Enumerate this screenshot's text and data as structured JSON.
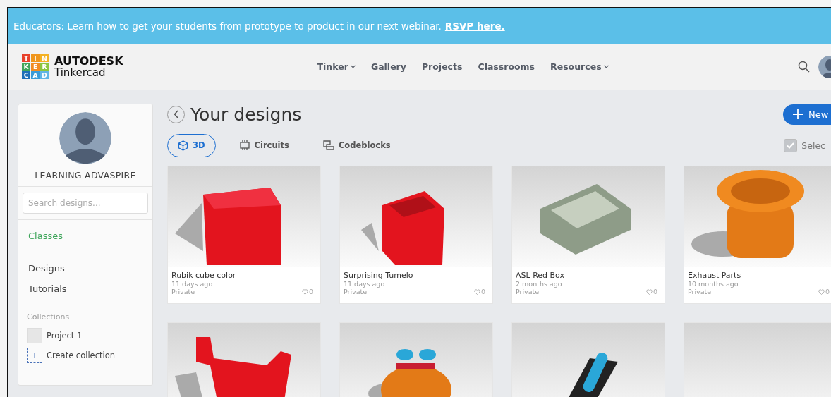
{
  "banner": {
    "text": "Educators: Learn how to get your students from prototype to product in our next webinar.",
    "link": "RSVP here."
  },
  "header": {
    "logo": {
      "tiles": [
        "T",
        "I",
        "N",
        "K",
        "E",
        "R",
        "C",
        "A",
        "D"
      ],
      "brand": "AUTODESK",
      "product": "Tinkercad"
    },
    "nav": [
      {
        "label": "Tinker",
        "dropdown": true
      },
      {
        "label": "Gallery",
        "dropdown": false
      },
      {
        "label": "Projects",
        "dropdown": false
      },
      {
        "label": "Classrooms",
        "dropdown": false
      },
      {
        "label": "Resources",
        "dropdown": true
      }
    ]
  },
  "sidebar": {
    "user_name": "LEARNING ADVASPIRE",
    "search": {
      "placeholder": "Search designs..."
    },
    "links": [
      {
        "label": "Classes",
        "accent": true
      }
    ],
    "menu": [
      {
        "label": "Designs",
        "accent": false
      },
      {
        "label": "Tutorials",
        "accent": false
      }
    ],
    "collections_heading": "Collections",
    "collections": [
      {
        "label": "Project 1",
        "kind": "collection"
      },
      {
        "label": "+",
        "kind": "create"
      }
    ],
    "create_label": "Create collection"
  },
  "main": {
    "title": "Your designs",
    "new_button": "New",
    "tabs": [
      {
        "label": "3D",
        "selected": true
      },
      {
        "label": "Circuits",
        "selected": false
      },
      {
        "label": "Codeblocks",
        "selected": false
      }
    ],
    "select": {
      "label": "Selec",
      "checked": true
    },
    "designs": [
      {
        "name": "Rubik cube color",
        "time": "11 days ago",
        "visibility": "Private",
        "likes": "0"
      },
      {
        "name": "Surprising Tumelo",
        "time": "11 days ago",
        "visibility": "Private",
        "likes": "0"
      },
      {
        "name": "ASL Red Box",
        "time": "2 months ago",
        "visibility": "Private",
        "likes": "0"
      },
      {
        "name": "Exhaust Parts",
        "time": "10 months ago",
        "visibility": "Private",
        "likes": "0"
      }
    ]
  }
}
